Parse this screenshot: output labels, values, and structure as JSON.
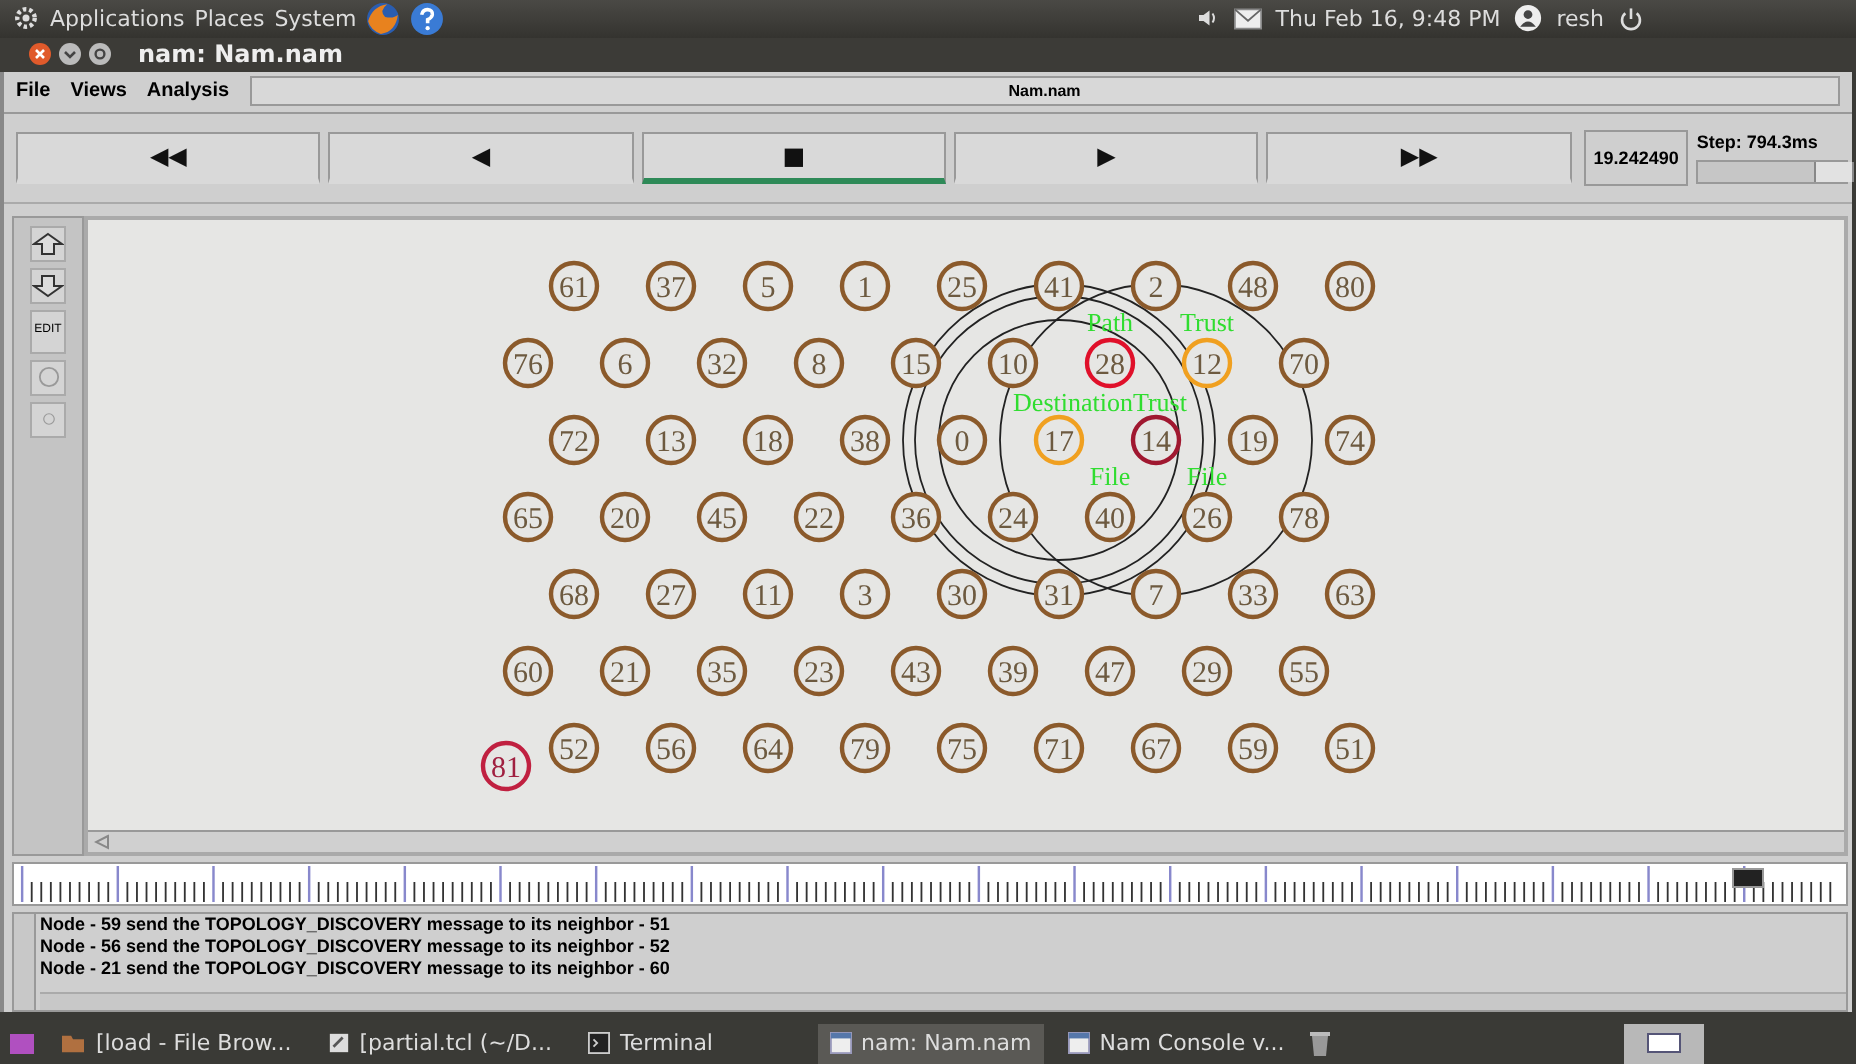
{
  "top_panel": {
    "menus": [
      "Applications",
      "Places",
      "System"
    ],
    "clock": "Thu Feb 16,  9:48 PM",
    "user": "resh"
  },
  "window": {
    "title": "nam: Nam.nam"
  },
  "menu_bar": {
    "items": [
      "File",
      "Views",
      "Analysis"
    ],
    "file_name": "Nam.nam"
  },
  "playback": {
    "buttons": [
      {
        "label": "◀◀",
        "selected": false
      },
      {
        "label": "◀",
        "selected": false
      },
      {
        "label": "■",
        "selected": true
      },
      {
        "label": "▶",
        "selected": false
      },
      {
        "label": "▶▶",
        "selected": false
      }
    ],
    "time": "19.242490",
    "step": {
      "label": "Step: 794.3ms",
      "level": 0.92
    }
  },
  "tools": [
    {
      "kind": "zoom-in"
    },
    {
      "kind": "zoom-out"
    },
    {
      "kind": "edit",
      "label": "EDIT"
    },
    {
      "kind": "circle"
    },
    {
      "kind": "dot"
    }
  ],
  "canvas": {
    "rows": [
      [
        {
          "label": "61",
          "color": "#8b5a2b"
        },
        {
          "label": "37",
          "color": "#8b5a2b"
        },
        {
          "label": "5",
          "color": "#8b5a2b"
        },
        {
          "label": "1",
          "color": "#8b5a2b"
        },
        {
          "label": "25",
          "color": "#8b5a2b"
        },
        {
          "label": "41",
          "color": "#8b5a2b"
        },
        {
          "label": "2",
          "color": "#8b5a2b"
        },
        {
          "label": "48",
          "color": "#8b5a2b"
        },
        {
          "label": "80",
          "color": "#8b5a2b"
        }
      ],
      [
        {
          "label": "76",
          "color": "#8b5a2b"
        },
        {
          "label": "6",
          "color": "#8b5a2b"
        },
        {
          "label": "32",
          "color": "#8b5a2b"
        },
        {
          "label": "8",
          "color": "#8b5a2b"
        },
        {
          "label": "15",
          "color": "#8b5a2b"
        },
        {
          "label": "10",
          "color": "#8b5a2b"
        },
        {
          "label": "28",
          "color": "#e0102a",
          "tags": [
            {
              "text": "Path",
              "kind": "above"
            },
            {
              "text": "DestinationTrust",
              "kind": "below"
            }
          ]
        },
        {
          "label": "12",
          "color": "#f0a020",
          "tags": [
            {
              "text": "Trust",
              "kind": "above"
            }
          ]
        },
        {
          "label": "70",
          "color": "#8b5a2b"
        }
      ],
      [
        {
          "label": "72",
          "color": "#8b5a2b"
        },
        {
          "label": "13",
          "color": "#8b5a2b"
        },
        {
          "label": "18",
          "color": "#8b5a2b"
        },
        {
          "label": "38",
          "color": "#8b5a2b"
        },
        {
          "label": "0",
          "color": "#8b5a2b"
        },
        {
          "label": "17",
          "color": "#f0a020",
          "rings": [
            {
              "kind": "large"
            },
            {
              "kind": "medium"
            },
            {
              "kind": "small"
            }
          ]
        },
        {
          "label": "14",
          "color": "#a01830",
          "rings": [
            {
              "kind": "large"
            }
          ]
        },
        {
          "label": "19",
          "color": "#8b5a2b"
        },
        {
          "label": "74",
          "color": "#8b5a2b"
        }
      ],
      [
        {
          "label": "65",
          "color": "#8b5a2b"
        },
        {
          "label": "20",
          "color": "#8b5a2b"
        },
        {
          "label": "45",
          "color": "#8b5a2b"
        },
        {
          "label": "22",
          "color": "#8b5a2b"
        },
        {
          "label": "36",
          "color": "#8b5a2b"
        },
        {
          "label": "24",
          "color": "#8b5a2b"
        },
        {
          "label": "40",
          "color": "#8b5a2b",
          "tags": [
            {
              "text": "File",
              "kind": "above"
            }
          ]
        },
        {
          "label": "26",
          "color": "#8b5a2b",
          "tags": [
            {
              "text": "File",
              "kind": "above"
            }
          ]
        },
        {
          "label": "78",
          "color": "#8b5a2b"
        }
      ],
      [
        {
          "label": "68",
          "color": "#8b5a2b"
        },
        {
          "label": "27",
          "color": "#8b5a2b"
        },
        {
          "label": "11",
          "color": "#8b5a2b"
        },
        {
          "label": "3",
          "color": "#8b5a2b"
        },
        {
          "label": "30",
          "color": "#8b5a2b"
        },
        {
          "label": "31",
          "color": "#8b5a2b"
        },
        {
          "label": "7",
          "color": "#8b5a2b"
        },
        {
          "label": "33",
          "color": "#8b5a2b"
        },
        {
          "label": "63",
          "color": "#8b5a2b"
        }
      ],
      [
        {
          "label": "60",
          "color": "#8b5a2b"
        },
        {
          "label": "21",
          "color": "#8b5a2b"
        },
        {
          "label": "35",
          "color": "#8b5a2b"
        },
        {
          "label": "23",
          "color": "#8b5a2b"
        },
        {
          "label": "43",
          "color": "#8b5a2b"
        },
        {
          "label": "39",
          "color": "#8b5a2b"
        },
        {
          "label": "47",
          "color": "#8b5a2b"
        },
        {
          "label": "29",
          "color": "#8b5a2b"
        },
        {
          "label": "55",
          "color": "#8b5a2b"
        }
      ],
      [
        {
          "label": "52",
          "color": "#8b5a2b"
        },
        {
          "label": "56",
          "color": "#8b5a2b"
        },
        {
          "label": "64",
          "color": "#8b5a2b"
        },
        {
          "label": "79",
          "color": "#8b5a2b"
        },
        {
          "label": "75",
          "color": "#8b5a2b"
        },
        {
          "label": "71",
          "color": "#8b5a2b"
        },
        {
          "label": "67",
          "color": "#8b5a2b"
        },
        {
          "label": "59",
          "color": "#8b5a2b"
        },
        {
          "label": "51",
          "color": "#8b5a2b"
        }
      ]
    ],
    "stray_nodes": [
      {
        "label": "81",
        "color": "#c02040"
      }
    ]
  },
  "timeline": {
    "level": 0.955
  },
  "log": {
    "lines": [
      "Node - 59 send the TOPOLOGY_DISCOVERY message to its neighbor - 51",
      "Node - 56 send the TOPOLOGY_DISCOVERY message to its neighbor - 52",
      "Node - 21 send the TOPOLOGY_DISCOVERY message to its neighbor - 60"
    ]
  },
  "taskbar": {
    "items": [
      {
        "label": "[load - File Brow...",
        "kind": "folder",
        "selected": false
      },
      {
        "label": "[partial.tcl (~/D...",
        "kind": "editor",
        "selected": false
      },
      {
        "label": "Terminal",
        "kind": "terminal",
        "selected": false
      },
      {
        "label": "nam: Nam.nam",
        "kind": "window",
        "selected": true
      },
      {
        "label": "Nam Console v...",
        "kind": "window",
        "selected": false
      }
    ]
  }
}
